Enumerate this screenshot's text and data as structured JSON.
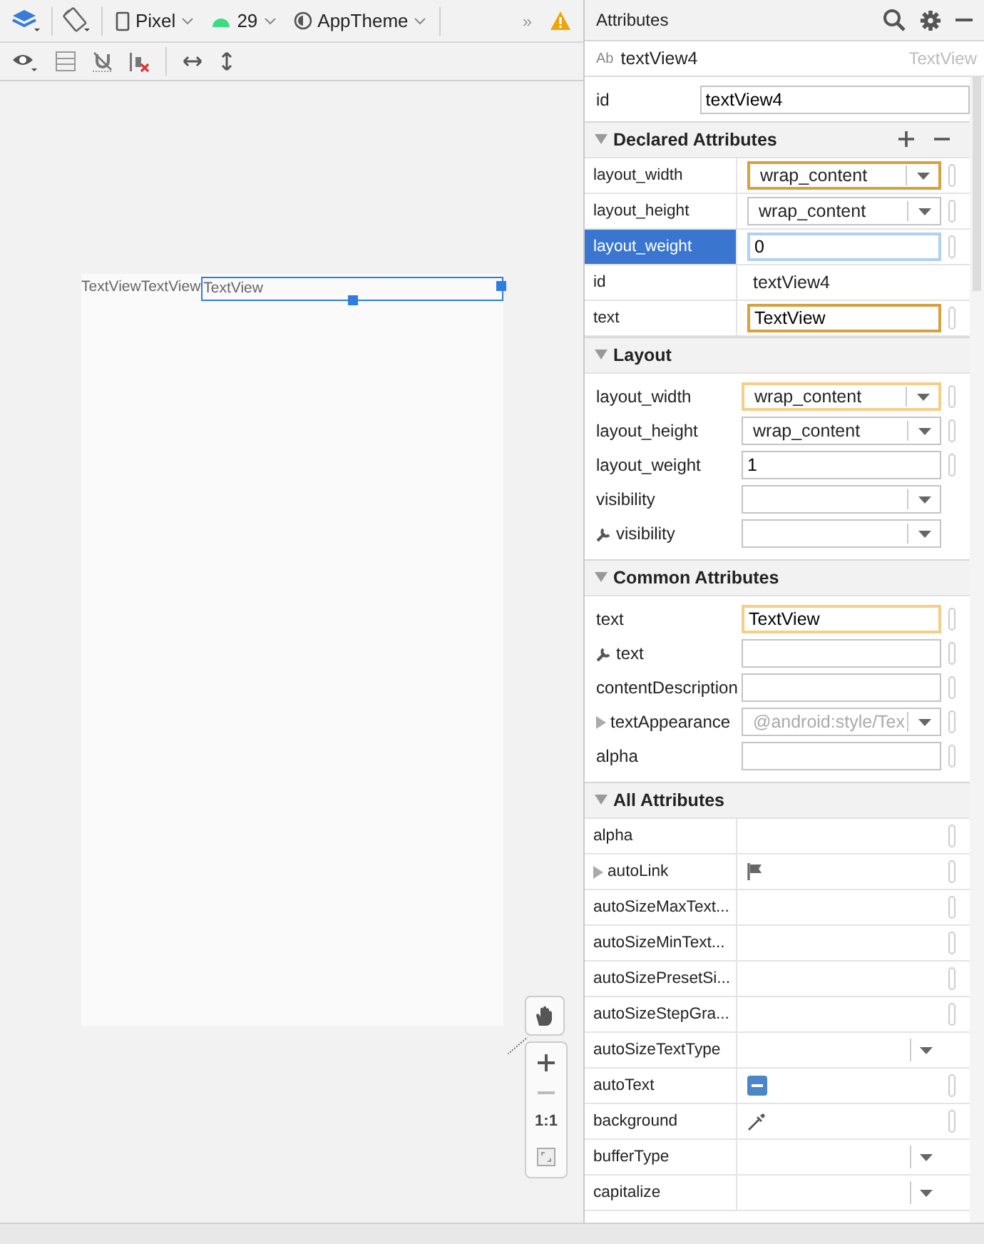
{
  "toolbar": {
    "device": "Pixel",
    "api_level": "29",
    "theme": "AppTheme",
    "overflow": "»"
  },
  "canvas": {
    "views": [
      {
        "text": "TextView",
        "selected": false
      },
      {
        "text": "TextView",
        "selected": false
      },
      {
        "text": "TextView",
        "selected": true
      }
    ],
    "zoom": {
      "actual_size": "1:1"
    }
  },
  "attributes": {
    "title": "Attributes",
    "component": {
      "badge": "Ab",
      "name": "textView4",
      "type": "TextView"
    },
    "id_row": {
      "label": "id",
      "value": "textView4"
    },
    "sections": [
      {
        "title": "Declared Attributes",
        "kind": "grid",
        "expanded": true,
        "editable": true,
        "rows": [
          {
            "label": "layout_width",
            "kind": "dropdown",
            "value": "wrap_content",
            "color": "#d9a040",
            "selected": false
          },
          {
            "label": "layout_height",
            "kind": "dropdown",
            "value": "wrap_content",
            "selected": false
          },
          {
            "label": "layout_weight",
            "kind": "field",
            "value": "0",
            "selected": true
          },
          {
            "label": "id",
            "kind": "plain",
            "value": "textView4",
            "selected": false
          },
          {
            "label": "text",
            "kind": "field",
            "value": "TextView",
            "color": "#d9a040",
            "selected": false
          }
        ]
      },
      {
        "title": "Layout",
        "kind": "form",
        "expanded": true,
        "rows": [
          {
            "label": "layout_width",
            "kind": "dropdown",
            "value": "wrap_content",
            "color": "#f5cf8a"
          },
          {
            "label": "layout_height",
            "kind": "dropdown",
            "value": "wrap_content"
          },
          {
            "label": "layout_weight",
            "kind": "field",
            "value": "1"
          },
          {
            "label": "visibility",
            "kind": "dropdown",
            "pill": false
          },
          {
            "label": "visibility",
            "kind": "dropdown",
            "tool": true,
            "pill": false
          }
        ]
      },
      {
        "title": "Common Attributes",
        "kind": "form",
        "expanded": true,
        "rows": [
          {
            "label": "text",
            "kind": "field",
            "value": "TextView",
            "color": "#f5cf8a"
          },
          {
            "label": "text",
            "kind": "field",
            "tool": true
          },
          {
            "label": "contentDescription",
            "kind": "field"
          },
          {
            "label": "textAppearance",
            "kind": "dropdown",
            "placeholder": "@android:style/Tex",
            "expandable": true
          },
          {
            "label": "alpha",
            "kind": "field"
          }
        ]
      },
      {
        "title": "All Attributes",
        "kind": "grid",
        "expanded": true,
        "rows": [
          {
            "label": "alpha",
            "kind": "empty"
          },
          {
            "label": "autoLink",
            "kind": "flag",
            "expandable": true
          },
          {
            "label": "autoSizeMaxText...",
            "kind": "empty"
          },
          {
            "label": "autoSizeMinText...",
            "kind": "empty"
          },
          {
            "label": "autoSizePresetSi...",
            "kind": "empty"
          },
          {
            "label": "autoSizeStepGra...",
            "kind": "empty"
          },
          {
            "label": "autoSizeTextType",
            "kind": "dropdown",
            "pill": false
          },
          {
            "label": "autoText",
            "kind": "boolean",
            "indeterminate": true
          },
          {
            "label": "background",
            "kind": "color"
          },
          {
            "label": "bufferType",
            "kind": "dropdown",
            "pill": false
          },
          {
            "label": "capitalize",
            "kind": "dropdown",
            "pill": false
          }
        ]
      }
    ]
  }
}
